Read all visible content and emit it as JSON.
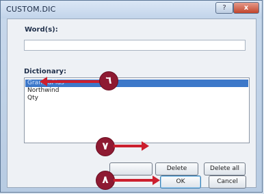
{
  "window": {
    "title": "CUSTOM.DIC",
    "help_label": "?",
    "close_label": "x"
  },
  "words": {
    "label": "Word(s):",
    "value": ""
  },
  "dictionary": {
    "label": "Dictionary:",
    "items": [
      "GranolaPlus",
      "Northwind",
      "Qty"
    ],
    "selected_index": 0
  },
  "buttons": {
    "add": "",
    "delete": "Delete",
    "delete_all": "Delete all",
    "ok": "OK",
    "cancel": "Cancel"
  },
  "callouts": {
    "step6": "٦",
    "step7": "٧",
    "step8": "٨"
  },
  "colors": {
    "callout": "#8e1a32",
    "arrow": "#cc1f2e",
    "selection": "#3d78c9"
  }
}
